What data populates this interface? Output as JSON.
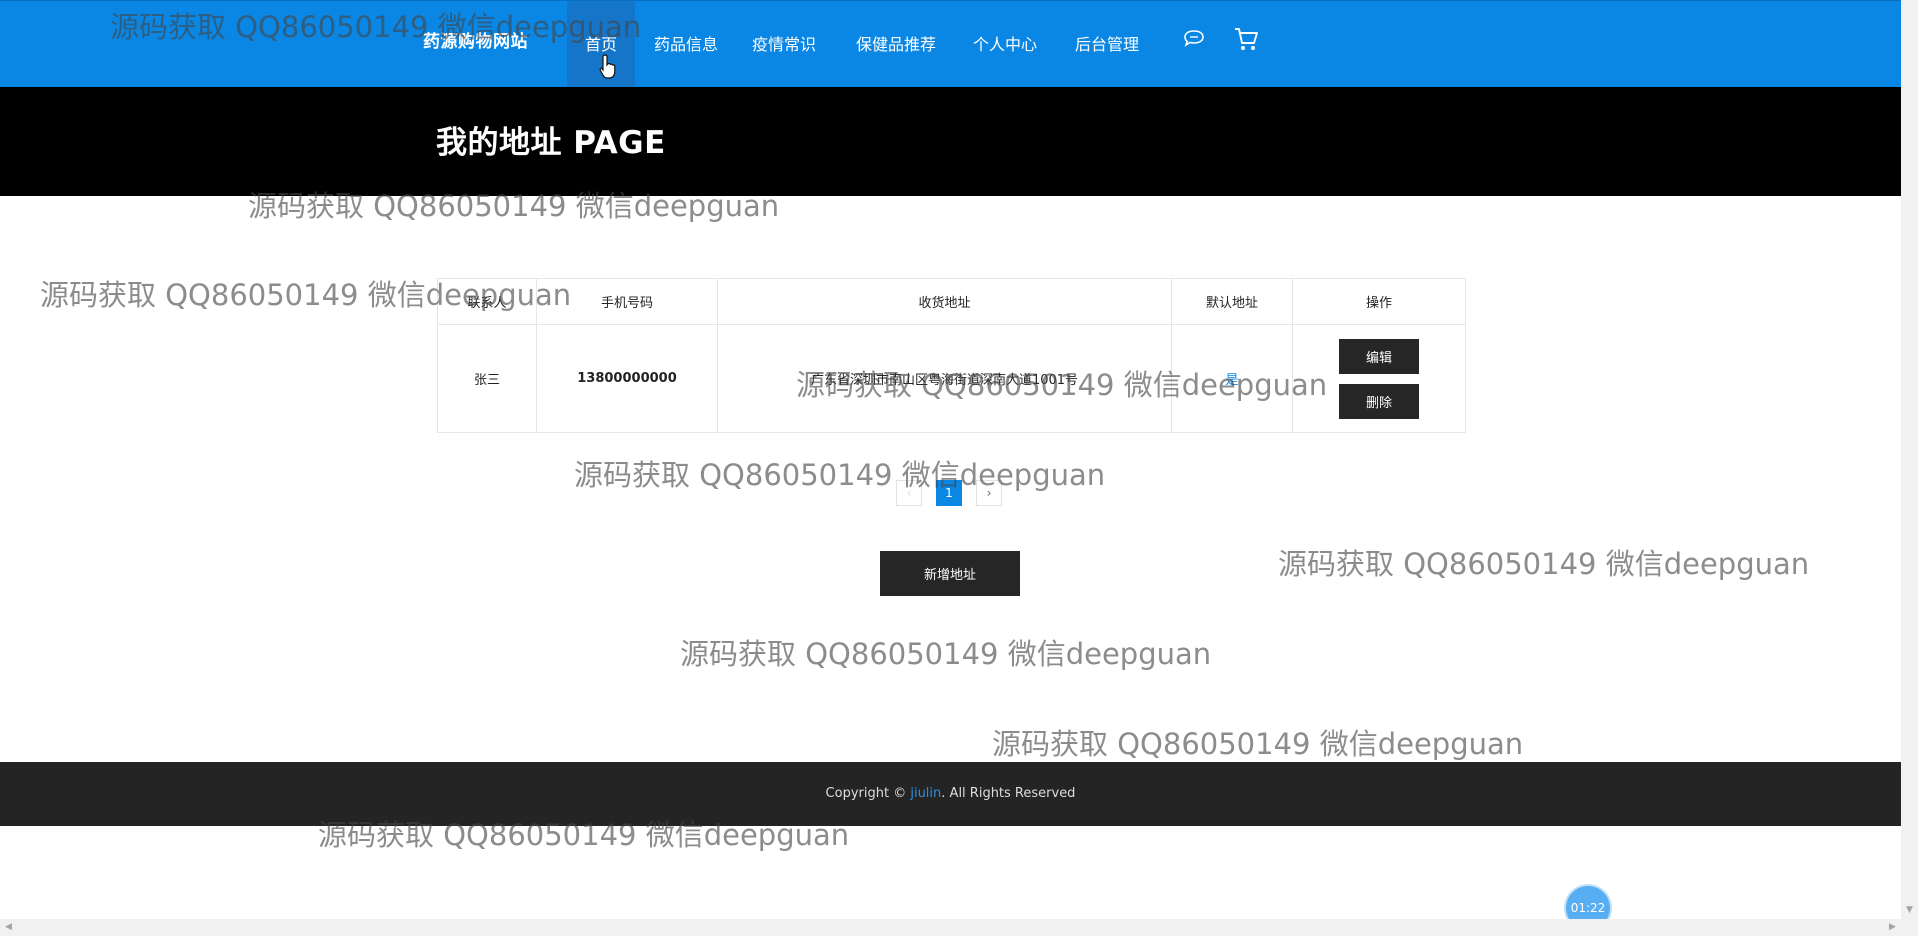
{
  "header": {
    "brand": "药源购物网站",
    "nav": [
      {
        "label": "首页",
        "active": true
      },
      {
        "label": "药品信息"
      },
      {
        "label": "疫情常识"
      },
      {
        "label": "保健品推荐"
      },
      {
        "label": "个人中心"
      },
      {
        "label": "后台管理"
      }
    ],
    "icons": [
      "chat-icon",
      "cart-icon"
    ]
  },
  "banner": {
    "title": "我的地址 PAGE"
  },
  "table": {
    "headers": [
      "联系人",
      "手机号码",
      "收货地址",
      "默认地址",
      "操作"
    ],
    "rows": [
      {
        "contact": "张三",
        "phone": "13800000000",
        "address": "广东省深圳市南山区粤海街道深南大道1001号",
        "default": "是",
        "actions": {
          "edit": "编辑",
          "delete": "删除"
        }
      }
    ]
  },
  "pagination": {
    "prev": "‹",
    "current": "1",
    "next": "›"
  },
  "add_button": "新增地址",
  "footer": {
    "prefix": "Copyright © ",
    "link": "jiulin",
    "suffix": ". All Rights Reserved"
  },
  "watermark": "源码获取 QQ86050149 微信deepguan",
  "timer": "01:22",
  "colors": {
    "primary": "#0a86e4",
    "black": "#000000",
    "dark": "#262626"
  }
}
